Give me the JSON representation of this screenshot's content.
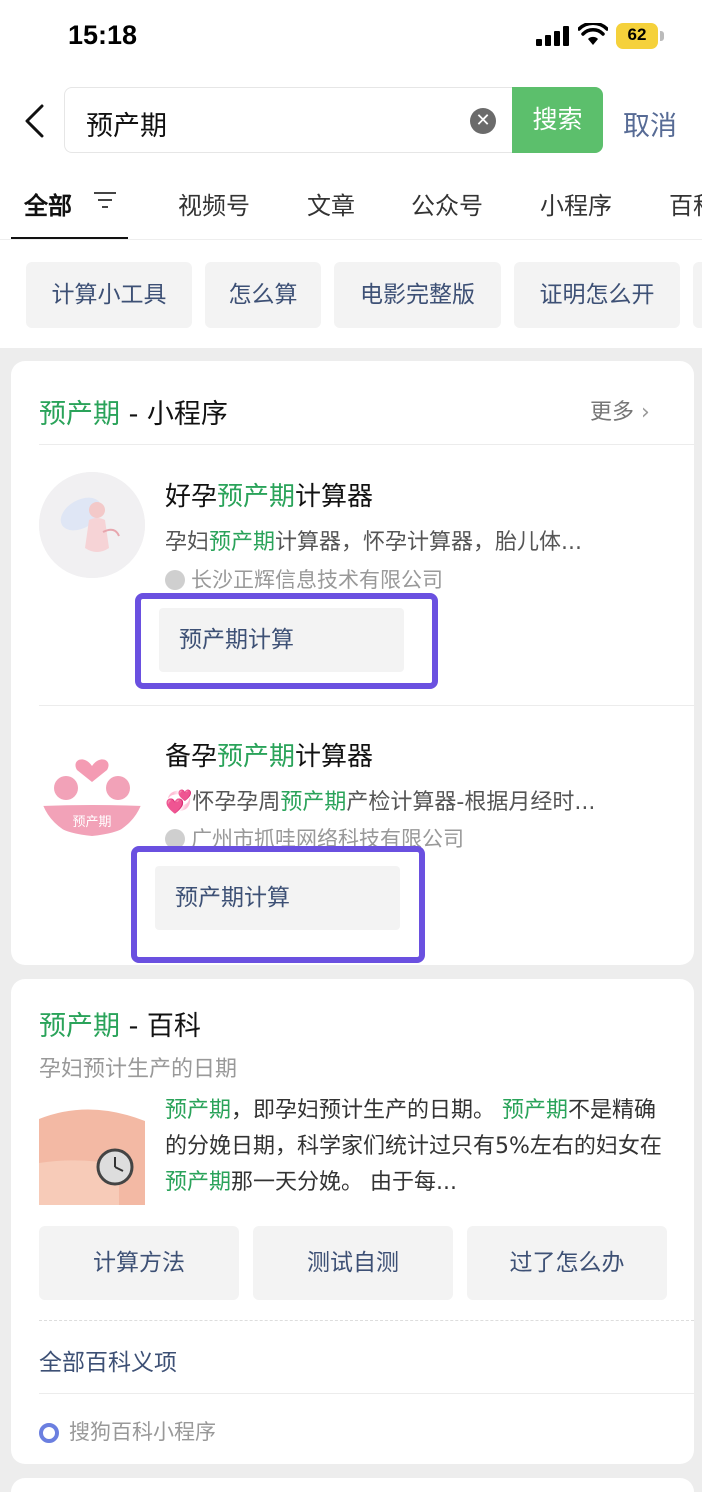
{
  "status_bar": {
    "time": "15:18",
    "battery": "62"
  },
  "search": {
    "query": "预产期",
    "button": "搜索",
    "cancel": "取消"
  },
  "tabs": [
    {
      "label": "全部"
    },
    {
      "label": "视频号"
    },
    {
      "label": "文章"
    },
    {
      "label": "公众号"
    },
    {
      "label": "小程序"
    },
    {
      "label": "百科"
    }
  ],
  "chips": [
    "计算小工具",
    "怎么算",
    "电影完整版",
    "证明怎么开"
  ],
  "mini_section": {
    "keyword": "预产期",
    "suffix": " - 小程序",
    "more": "更多",
    "apps": [
      {
        "name_pre": "好孕",
        "name_kw": "预产期",
        "name_post": "计算器",
        "desc_pre": "孕妇",
        "desc_kw": "预产期",
        "desc_post": "计算器，怀孕计算器，胎儿体...",
        "company": "长沙正辉信息技术有限公司",
        "action": "预产期计算"
      },
      {
        "name_pre": "备孕",
        "name_kw": "预产期",
        "name_post": "计算器",
        "desc_pre": "💞怀孕孕周",
        "desc_kw": "预产期",
        "desc_post": "产检计算器-根据月经时...",
        "company": "广州市抓哇网络科技有限公司",
        "action": "预产期计算",
        "avatar_label": "预产期"
      }
    ]
  },
  "baike_section": {
    "keyword": "预产期",
    "suffix": " - 百科",
    "subtitle": "孕妇预计生产的日期",
    "summary": [
      {
        "kw": "预产期",
        "text": "，即孕妇预计生产的日期。 "
      },
      {
        "kw": "预产期",
        "text": "不是精确的分娩日期，科学家们统计过只有5%左右的妇女在"
      },
      {
        "kw": "预产期",
        "text": "那一天分娩。 由于每..."
      }
    ],
    "buttons": [
      "计算方法",
      "测试自测",
      "过了怎么办"
    ],
    "all_link": "全部百科义项",
    "source": "搜狗百科小程序"
  },
  "colors": {
    "accent_green": "#2aa35a",
    "search_green": "#5cbf6c",
    "highlight_box": "#6a50e0",
    "link_blue": "#3d5075"
  }
}
